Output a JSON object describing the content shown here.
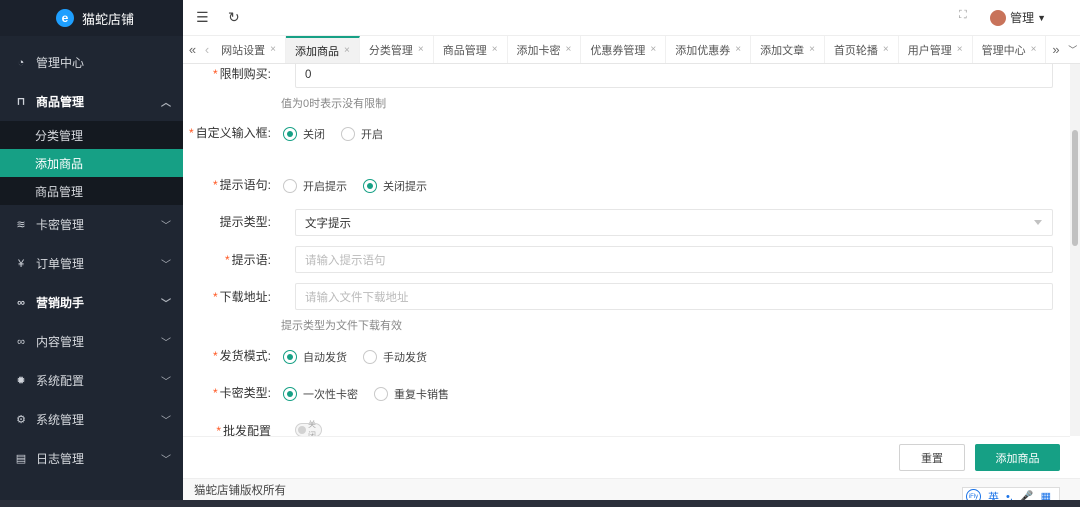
{
  "brand": {
    "name": "猫蛇店铺",
    "logo_letter": "e"
  },
  "sidebar": {
    "items": [
      {
        "label": "管理中心",
        "icon": "dashboard-icon"
      },
      {
        "label": "商品管理",
        "icon": "cart-icon",
        "expanded": true
      },
      {
        "label": "卡密管理",
        "icon": "layers-icon"
      },
      {
        "label": "订单管理",
        "icon": "yen-icon"
      },
      {
        "label": "营销助手",
        "icon": "infinity-icon"
      },
      {
        "label": "内容管理",
        "icon": "infinity-icon"
      },
      {
        "label": "系统配置",
        "icon": "gear-icon"
      },
      {
        "label": "系统管理",
        "icon": "gear-icon"
      },
      {
        "label": "日志管理",
        "icon": "file-icon"
      }
    ],
    "sub_items": [
      "分类管理",
      "添加商品",
      "商品管理"
    ]
  },
  "topbar": {
    "user": "管理"
  },
  "tabs": [
    "网站设置",
    "添加商品",
    "分类管理",
    "商品管理",
    "添加卡密",
    "优惠券管理",
    "添加优惠券",
    "添加文章",
    "首页轮播",
    "用户管理",
    "管理中心"
  ],
  "form": {
    "limit_label": "限制购买:",
    "limit_value": "0",
    "limit_hint": "值为0时表示没有限制",
    "custom_input_label": "自定义输入框:",
    "custom_input_opts": [
      "关闭",
      "开启"
    ],
    "tip_label": "提示语句:",
    "tip_opts": [
      "开启提示",
      "关闭提示"
    ],
    "tip_type_label": "提示类型:",
    "tip_type_value": "文字提示",
    "tip_text_label": "提示语:",
    "tip_text_placeholder": "请输入提示语句",
    "download_label": "下载地址:",
    "download_placeholder": "请输入文件下载地址",
    "download_hint": "提示类型为文件下载有效",
    "ship_label": "发货模式:",
    "ship_opts": [
      "自动发货",
      "手动发货"
    ],
    "card_label": "卡密类型:",
    "card_opts": [
      "一次性卡密",
      "重复卡销售"
    ],
    "batch_label": "批发配置",
    "batch_switch": "关闭"
  },
  "actions": {
    "reset": "重置",
    "add": "添加商品"
  },
  "footer": {
    "copyright": "猫蛇店铺版权所有"
  },
  "ime": {
    "lang": "英"
  },
  "colors": {
    "accent": "#16a085",
    "sidebar": "#1f2632"
  }
}
